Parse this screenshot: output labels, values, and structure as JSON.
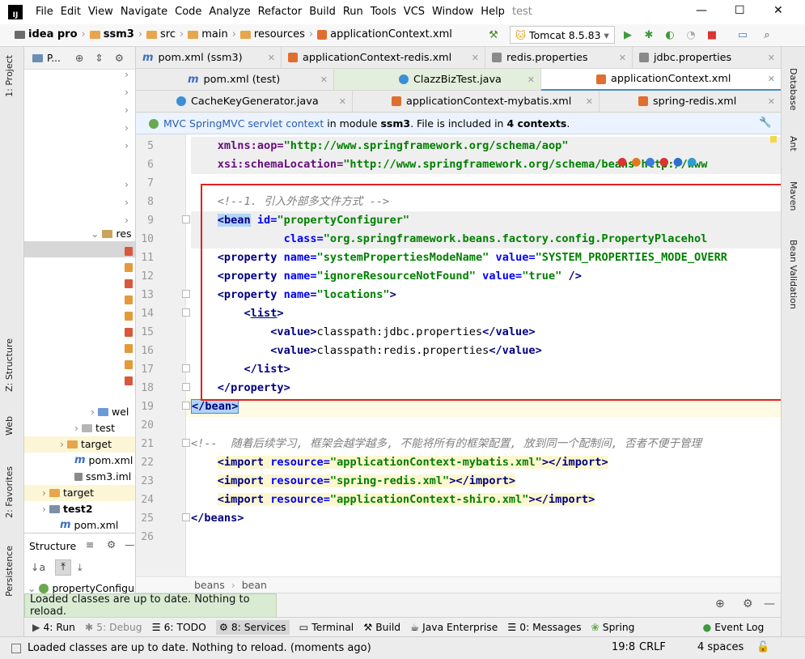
{
  "menu": {
    "items": [
      "File",
      "Edit",
      "View",
      "Navigate",
      "Code",
      "Analyze",
      "Refactor",
      "Build",
      "Run",
      "Tools",
      "VCS",
      "Window",
      "Help"
    ],
    "project_title": "test"
  },
  "window": {
    "minimize": "—",
    "maximize": "☐",
    "close": "✕"
  },
  "nav": {
    "crumbs": [
      "idea pro",
      "ssm3",
      "src",
      "main",
      "resources",
      "applicationContext.xml"
    ],
    "run_config": "Tomcat 8.5.83"
  },
  "project_panel": {
    "title": "P...",
    "tree": [
      "res",
      "wel",
      "test",
      "target",
      "pom.xml",
      "ssm3.iml",
      "target",
      "test2",
      "pom.xml"
    ]
  },
  "structure_panel": {
    "title": "Structure",
    "node": "propertyConfigu"
  },
  "tabs": {
    "row1": [
      "pom.xml (ssm3)",
      "applicationContext-redis.xml",
      "redis.properties",
      "jdbc.properties"
    ],
    "row2": [
      "pom.xml (test)",
      "ClazzBizTest.java",
      "applicationContext.xml"
    ],
    "row3": [
      "CacheKeyGenerator.java",
      "applicationContext-mybatis.xml",
      "spring-redis.xml"
    ]
  },
  "banner": {
    "link": "MVC SpringMVC servlet context",
    "text1": " in module ",
    "module": "ssm3",
    "text2": ". File is included in ",
    "count": "4 contexts",
    "text3": "."
  },
  "editor": {
    "line_numbers": [
      "5",
      "6",
      "7",
      "8",
      "9",
      "10",
      "11",
      "12",
      "13",
      "14",
      "15",
      "16",
      "17",
      "18",
      "19",
      "20",
      "21",
      "22",
      "23",
      "24",
      "25",
      "26"
    ],
    "code": {
      "l5_attr": "xmlns:aop=",
      "l5_val": "\"http://www.springframework.org/schema/aop\"",
      "l6_attr": "xsi:schemaLocation=",
      "l6_val": "\"http://www.springframework.org/schema/beans http://www",
      "l8_comment": "<!--1. 引入外部多文件方式 -->",
      "l9_tag": "bean",
      "l9_attr": "id=",
      "l9_val": "\"propertyConfigurer\"",
      "l10_attr": "class=",
      "l10_val": "\"org.springframework.beans.factory.config.PropertyPlacehol",
      "l11_tag": "<property",
      "l11_attr1": "name=",
      "l11_val1": "\"systemPropertiesModeName\"",
      "l11_attr2": "value=",
      "l11_val2": "\"SYSTEM_PROPERTIES_MODE_OVERR",
      "l12_tag": "<property",
      "l12_attr1": "name=",
      "l12_val1": "\"ignoreResourceNotFound\"",
      "l12_attr2": "value=",
      "l12_val2": "\"true\"",
      "l12_end": " />",
      "l13_tag": "<property",
      "l13_attr": "name=",
      "l13_val": "\"locations\"",
      "l13_end": ">",
      "l14_open": "<",
      "l14_tag": "list",
      "l14_close": ">",
      "l15_open": "<value>",
      "l15_text": "classpath:jdbc.properties",
      "l15_close": "</value>",
      "l16_open": "<value>",
      "l16_text": "classpath:redis.properties",
      "l16_close": "</value>",
      "l17": "</list>",
      "l18": "</property>",
      "l19": "</bean>",
      "l21_comment": "<!--  随着后续学习, 框架会越学越多, 不能将所有的框架配置, 放到同一个配制间, 否者不便于管理",
      "l22_tag": "<import",
      "l22_attr": "resource=",
      "l22_val": "\"applicationContext-mybatis.xml\"",
      "l22_end": "></import>",
      "l23_tag": "<import",
      "l23_attr": "resource=",
      "l23_val": "\"spring-redis.xml\"",
      "l23_end": "></import>",
      "l24_tag": "<import",
      "l24_attr": "resource=",
      "l24_val": "\"applicationContext-shiro.xml\"",
      "l24_end": "></import>",
      "l25": "</beans>"
    }
  },
  "editor_breadcrumb": [
    "beans",
    "bean"
  ],
  "balloon": {
    "text": "Loaded classes are up to date. Nothing to reload."
  },
  "tool_windows": [
    {
      "icon": "▶",
      "label": "4: Run"
    },
    {
      "icon": "✱",
      "label": "5: Debug"
    },
    {
      "icon": "☰",
      "label": "6: TODO"
    },
    {
      "icon": "⚙",
      "label": "8: Services"
    },
    {
      "icon": "▭",
      "label": "Terminal"
    },
    {
      "icon": "⚒",
      "label": "Build"
    },
    {
      "icon": "☕",
      "label": "Java Enterprise"
    },
    {
      "icon": "☰",
      "label": "0: Messages"
    },
    {
      "icon": "❀",
      "label": "Spring"
    },
    {
      "icon": "●",
      "label": "Event Log"
    }
  ],
  "left_stripe": [
    "1: Project",
    "Z: Structure",
    "Web",
    "2: Favorites",
    "Persistence"
  ],
  "right_stripe": [
    "Database",
    "Ant",
    "Maven",
    "Bean Validation"
  ],
  "status": {
    "message": "Loaded classes are up to date. Nothing to reload. (moments ago)",
    "position": "19:8",
    "line_sep": "CRLF",
    "indent": "4 spaces"
  },
  "colors": {
    "accent": "#4a88c7",
    "highlight_box": "#e1201f",
    "tag": "#000080",
    "attr": "#0000ff",
    "value": "#008000"
  }
}
